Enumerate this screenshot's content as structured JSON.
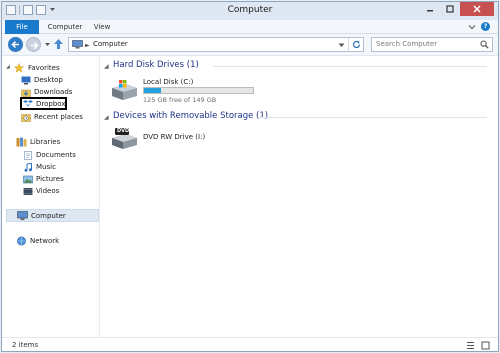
{
  "window": {
    "title": "Computer"
  },
  "ribbon": {
    "tabs": [
      "File",
      "Computer",
      "View"
    ]
  },
  "address": {
    "path": "Computer",
    "search_placeholder": "Search Computer"
  },
  "sidebar": {
    "favorites": {
      "label": "Favorites",
      "items": [
        "Desktop",
        "Downloads",
        "Dropbox",
        "Recent places"
      ]
    },
    "libraries": {
      "label": "Libraries",
      "items": [
        "Documents",
        "Music",
        "Pictures",
        "Videos"
      ]
    },
    "computer": {
      "label": "Computer"
    },
    "network": {
      "label": "Network"
    }
  },
  "main": {
    "hard_disks": {
      "header": "Hard Disk Drives (1)",
      "drive": {
        "name": "Local Disk (C:)",
        "free_text": "125 GB free of 149 GB",
        "used_fraction": 0.16
      }
    },
    "removable": {
      "header": "Devices with Removable Storage (1)",
      "drive": {
        "name": "DVD RW Drive (I:)",
        "badge": "DVD"
      }
    }
  },
  "status": {
    "items_text": "2 items"
  },
  "colors": {
    "accent": "#1979ca",
    "header_text": "#1e3287",
    "usage_bar": "#26a0da",
    "close_button": "#c75050"
  }
}
